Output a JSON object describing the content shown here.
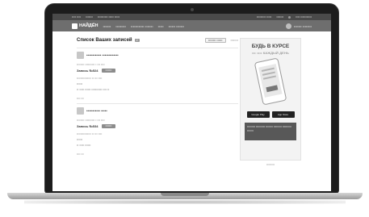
{
  "topbar": {
    "links": [
      "•••• ••••",
      "•••••••",
      "•••••••••• ••••• •••••"
    ],
    "right_links": [
      "••••••••• •••••",
      "•••••••",
      "•••• •••••••••••"
    ]
  },
  "header": {
    "logo_text": "НАЙДЁН",
    "nav": [
      "•••••••",
      "•••••••••",
      "•••••••••••• •••••••",
      "•••••",
      "•••••• •••••••"
    ],
    "user_name": "••••••• ••••••••"
  },
  "main": {
    "title": "Список Ваших записей",
    "count": "2",
    "add_button": "•••••••• ••••••",
    "link": "••••••••",
    "cards": [
      {
        "pet": "•••••••••••• •••••••••••••",
        "info": "•••••••• •••••••••• • ••• ••••",
        "record_id": "Запись №524",
        "status": "•••••••",
        "line1": "••••••••••••••• •• ••• ••••",
        "line2": "••••••",
        "line3": "•• ••••• •••••• ••••••••••• •••• ••",
        "more": "•••• •••"
      },
      {
        "pet": "••••••••••• •••••",
        "info": "•••••••• •••••••••• • ••• ••••",
        "record_id": "Запись №534",
        "status": "•••••••",
        "line1": "••••••••••••••• •• ••• ••••",
        "line2": "••••••",
        "line3": "•• ••••• ••••••",
        "more": "•••• •••"
      }
    ]
  },
  "ad": {
    "title": "БУДЬ В КУРСЕ",
    "subtitle": "••• •••• КАЖДЫЙ ДЕНЬ",
    "store1": "Google Play",
    "store2": "App Store",
    "promo": "••••••••• •••••••••• •••••••• ••••••••• •••••••••• •••••••",
    "caption": "•••••••••"
  }
}
